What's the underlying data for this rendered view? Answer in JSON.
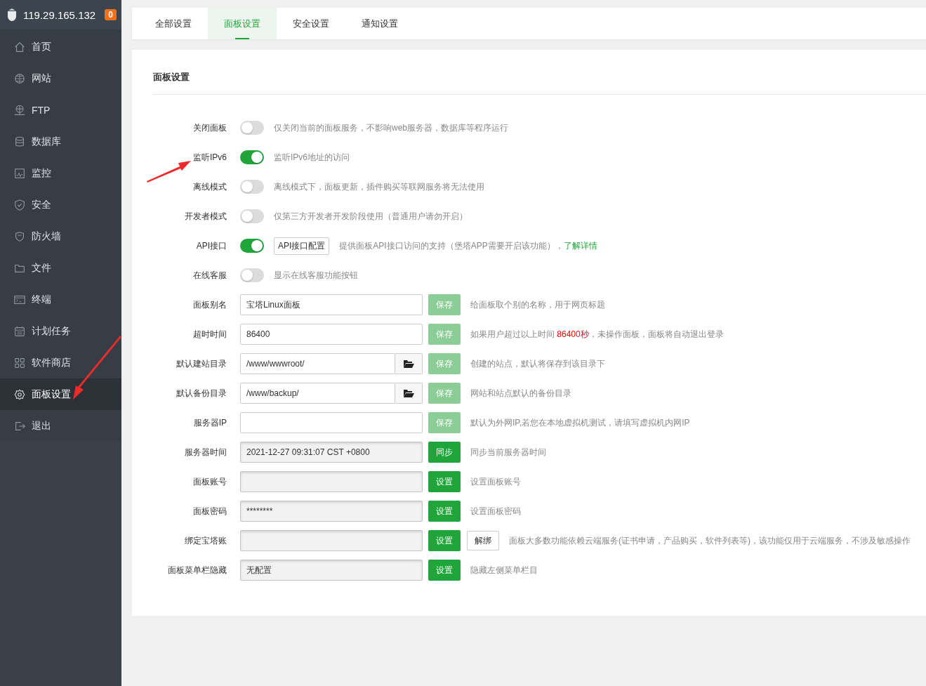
{
  "sidebar": {
    "host": "119.29.165.132",
    "badge": "0",
    "items": [
      {
        "label": "首页",
        "selected": false
      },
      {
        "label": "网站",
        "selected": false
      },
      {
        "label": "FTP",
        "selected": false
      },
      {
        "label": "数据库",
        "selected": false
      },
      {
        "label": "监控",
        "selected": false
      },
      {
        "label": "安全",
        "selected": false
      },
      {
        "label": "防火墙",
        "selected": false
      },
      {
        "label": "文件",
        "selected": false
      },
      {
        "label": "终端",
        "selected": false
      },
      {
        "label": "计划任务",
        "selected": false
      },
      {
        "label": "软件商店",
        "selected": false
      },
      {
        "label": "面板设置",
        "selected": true
      },
      {
        "label": "退出",
        "selected": false
      }
    ]
  },
  "tabs": [
    {
      "label": "全部设置",
      "selected": false
    },
    {
      "label": "面板设置",
      "selected": true
    },
    {
      "label": "安全设置",
      "selected": false
    },
    {
      "label": "通知设置",
      "selected": false
    }
  ],
  "section_title": "面板设置",
  "settings": [
    {
      "kind": "toggle",
      "label": "关闭面板",
      "on": false,
      "description": [
        {
          "kind": "plain",
          "text": "仅关闭当前的面板服务，不影响web服务器，数据库等程序运行"
        }
      ]
    },
    {
      "kind": "toggle",
      "label": "监听IPv6",
      "on": true,
      "description": [
        {
          "kind": "plain",
          "text": "监听IPv6地址的访问"
        }
      ]
    },
    {
      "kind": "toggle",
      "label": "离线模式",
      "on": false,
      "description": [
        {
          "kind": "plain",
          "text": "离线模式下，面板更新，插件购买等联网服务将无法使用"
        }
      ]
    },
    {
      "kind": "toggle",
      "label": "开发者模式",
      "on": false,
      "description": [
        {
          "kind": "plain",
          "text": "仅第三方开发者开发阶段使用（普通用户请勿开启）"
        }
      ]
    },
    {
      "kind": "toggle",
      "label": "API接口",
      "on": true,
      "config_button": "API接口配置",
      "description": [
        {
          "kind": "plain",
          "text": "提供面板API接口访问的支持（堡塔APP需要开启该功能），"
        },
        {
          "kind": "link",
          "text": "了解详情"
        }
      ]
    },
    {
      "kind": "toggle",
      "label": "在线客服",
      "on": false,
      "description": [
        {
          "kind": "plain",
          "text": "显示在线客服功能按钮"
        }
      ]
    },
    {
      "kind": "input",
      "label": "面板别名",
      "value": "宝塔Linux面板",
      "readonly": false,
      "button": {
        "label": "保存",
        "disabled": true
      },
      "description": [
        {
          "kind": "plain",
          "text": "给面板取个别的名称，用于网页标题"
        }
      ]
    },
    {
      "kind": "input",
      "label": "超时时间",
      "value": "86400",
      "readonly": false,
      "button": {
        "label": "保存",
        "disabled": true
      },
      "description": [
        {
          "kind": "plain",
          "text": "如果用户超过以上时间 "
        },
        {
          "kind": "warning",
          "text": "86400秒"
        },
        {
          "kind": "plain",
          "text": "，未操作面板，面板将自动退出登录"
        }
      ]
    },
    {
      "kind": "folder",
      "label": "默认建站目录",
      "value": "/www/wwwroot/",
      "readonly": false,
      "button": {
        "label": "保存",
        "disabled": true
      },
      "description": [
        {
          "kind": "plain",
          "text": "创建的站点，默认将保存到该目录下"
        }
      ]
    },
    {
      "kind": "folder",
      "label": "默认备份目录",
      "value": "/www/backup/",
      "readonly": false,
      "button": {
        "label": "保存",
        "disabled": true
      },
      "description": [
        {
          "kind": "plain",
          "text": "网站和站点默认的备份目录"
        }
      ]
    },
    {
      "kind": "input",
      "label": "服务器IP",
      "readonly": false,
      "button": {
        "label": "保存",
        "disabled": true
      },
      "description": [
        {
          "kind": "plain",
          "text": "默认为外网IP,若您在本地虚拟机测试，请填写虚拟机内网IP"
        }
      ]
    },
    {
      "kind": "input",
      "label": "服务器时间",
      "value": "2021-12-27 09:31:07 CST +0800",
      "readonly": true,
      "button": {
        "label": "同步",
        "disabled": false
      },
      "description": [
        {
          "kind": "plain",
          "text": "同步当前服务器时间"
        }
      ]
    },
    {
      "kind": "input",
      "label": "面板账号",
      "readonly": true,
      "button": {
        "label": "设置",
        "disabled": false
      },
      "description": [
        {
          "kind": "plain",
          "text": "设置面板账号"
        }
      ]
    },
    {
      "kind": "input",
      "label": "面板密码",
      "value": "********",
      "readonly": true,
      "button": {
        "label": "设置",
        "disabled": false
      },
      "description": [
        {
          "kind": "plain",
          "text": "设置面板密码"
        }
      ]
    },
    {
      "kind": "input",
      "label": "绑定宝塔账",
      "readonly": true,
      "button": {
        "label": "设置",
        "disabled": false
      },
      "extra_button": "解绑",
      "description": [
        {
          "kind": "plain",
          "text": "面板大多数功能依赖云端服务(证书申请，产品购买，软件列表等)，该功能仅用于云端服务，不涉及敏感操作"
        }
      ]
    },
    {
      "kind": "input",
      "label": "面板菜单栏隐藏",
      "value": "无配置",
      "readonly": true,
      "button": {
        "label": "设置",
        "disabled": false
      },
      "description": [
        {
          "kind": "plain",
          "text": "隐藏左侧菜单栏目"
        }
      ]
    }
  ]
}
